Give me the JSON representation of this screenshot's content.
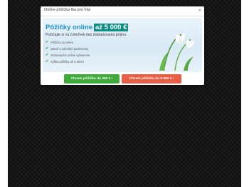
{
  "modal": {
    "title": "Online pôžička iba pre Vás",
    "close_label": "×"
  },
  "banner": {
    "headline_main": "Pôžičky online",
    "headline_highlight": "až 5 000 €",
    "subtitle": "Požičajte si na čokoľvek bez dokladovania príjmu.",
    "features": [
      "Pôžička na mieru",
      "Jasné a výhodné podmienky",
      "Jednoduché online vybavenie",
      "Výška pôžičky až 5 000 €"
    ]
  },
  "buttons": {
    "small_loan": "Chcem pôžičku do 250 € ›",
    "large_loan": "Chcem pôžičku do 5 000 € ›"
  },
  "colors": {
    "accent_blue": "#1f8fc9",
    "highlight_teal": "#0c8e86",
    "button_green": "#3fa93b",
    "button_orange": "#e65f45"
  }
}
